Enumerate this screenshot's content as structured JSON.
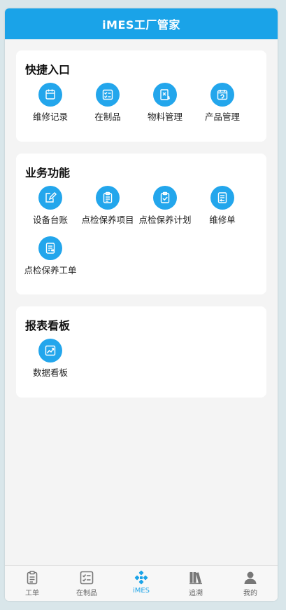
{
  "header": {
    "title": "iMES工厂管家"
  },
  "sections": {
    "quick": {
      "title": "快捷入口",
      "items": [
        "维修记录",
        "在制品",
        "物料管理",
        "产品管理"
      ]
    },
    "business": {
      "title": "业务功能",
      "items": [
        "设备台账",
        "点检保养项目",
        "点检保养计划",
        "维修单",
        "点检保养工单"
      ]
    },
    "reports": {
      "title": "报表看板",
      "items": [
        "数据看板"
      ]
    }
  },
  "tabbar": {
    "items": [
      {
        "label": "工单",
        "icon": "clipboard-icon"
      },
      {
        "label": "在制品",
        "icon": "checklist-icon"
      },
      {
        "label": "iMES",
        "icon": "imes-logo-icon"
      },
      {
        "label": "追溯",
        "icon": "books-icon"
      },
      {
        "label": "我的",
        "icon": "person-icon"
      }
    ],
    "active_index": 2
  },
  "colors": {
    "brand": "#1aa3e8",
    "icon_bg": "#23a6ec",
    "active_tab": "#1aa3e8"
  }
}
